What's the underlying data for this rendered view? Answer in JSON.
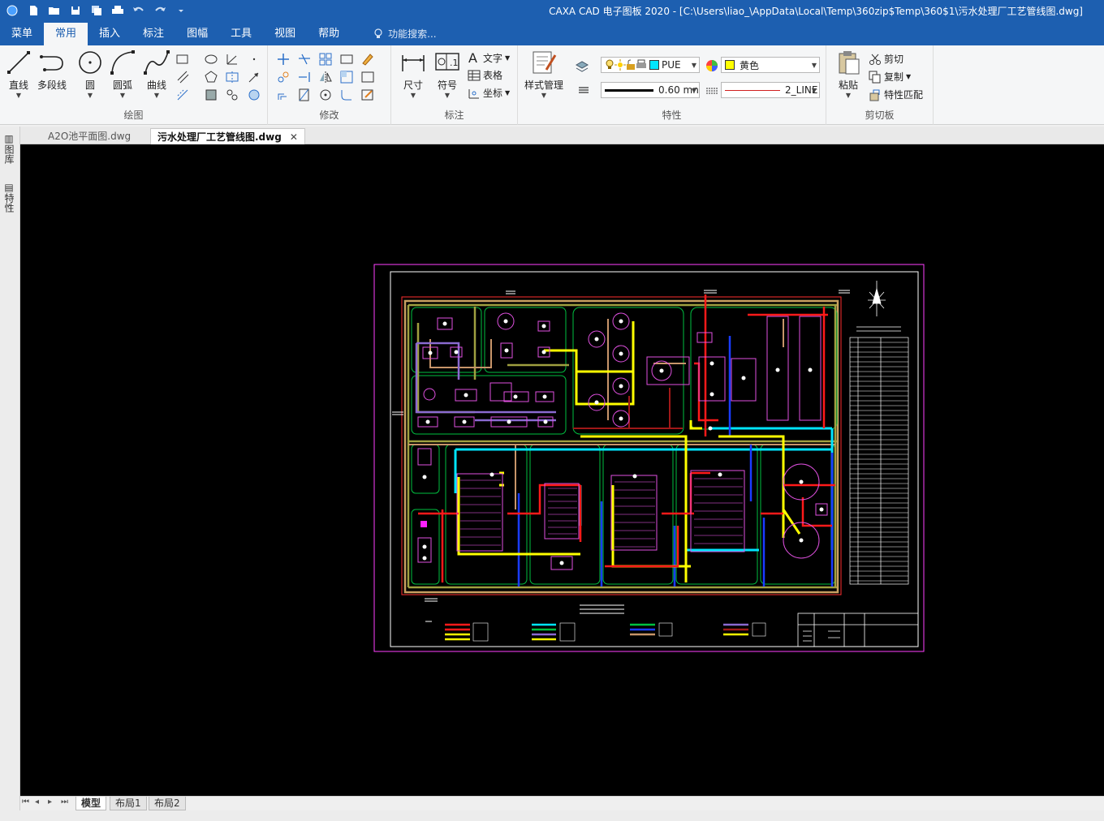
{
  "window": {
    "title": "CAXA CAD 电子图板 2020 - [C:\\Users\\liao_\\AppData\\Local\\Temp\\360zip$Temp\\360$1\\污水处理厂工艺管线图.dwg]"
  },
  "menu": {
    "tabs": [
      "菜单",
      "常用",
      "插入",
      "标注",
      "图幅",
      "工具",
      "视图",
      "帮助"
    ],
    "active": "常用",
    "search_placeholder": "功能搜索..."
  },
  "ribbon": {
    "draw": {
      "title": "绘图",
      "line": "直线",
      "polyline": "多段线",
      "circle": "圆",
      "arc": "圆弧",
      "curve": "曲线"
    },
    "modify": {
      "title": "修改"
    },
    "annotate": {
      "title": "标注",
      "dimension": "尺寸",
      "symbol": "符号",
      "text": "文字",
      "table": "表格",
      "coordinate": "坐标"
    },
    "properties": {
      "title": "特性",
      "style_manager": "样式管理",
      "layer": "PUE",
      "color": "黄色",
      "lineweight": "0.60 mn",
      "linetype": "2_LINE"
    },
    "clipboard": {
      "title": "剪切板",
      "paste": "粘贴",
      "cut": "剪切",
      "copy": "复制",
      "match": "特性匹配"
    }
  },
  "doc_tabs": [
    "A2O池平面图.dwg",
    "污水处理厂工艺管线图.dwg"
  ],
  "active_doc": "污水处理厂工艺管线图.dwg",
  "side_tabs": [
    "图库",
    "特性"
  ],
  "layout_tabs": [
    "模型",
    "布局1",
    "布局2"
  ],
  "active_layout": "模型",
  "colors": {
    "accent": "#1d5fb0",
    "canvas": "#000000",
    "pipe_red": "#ff1a1a",
    "pipe_yellow": "#ffff00",
    "pipe_cyan": "#00e5ff",
    "pipe_blue": "#1a3cff",
    "pipe_green": "#00c040",
    "pipe_brown": "#c8956a",
    "pipe_olive": "#a0a040",
    "pipe_purple": "#8a6ad0",
    "frame_magenta": "#ff40ff"
  }
}
